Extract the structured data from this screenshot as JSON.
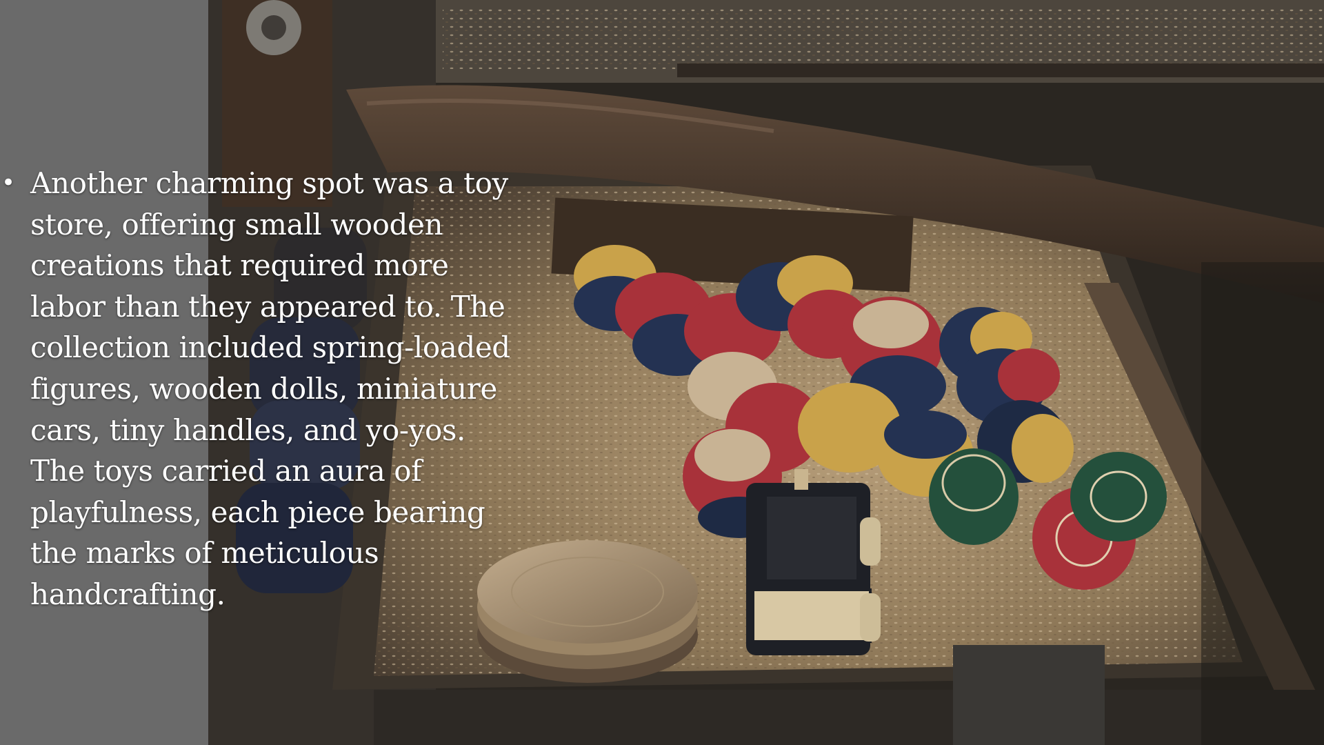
{
  "slide": {
    "bullet_text": "Another charming spot was a toy store, offering small wooden creations that required more labor than they appeared to. The collection included spring-loaded figures, wooden dolls, miniature cars, tiny handles, and yo-yos. The toys carried an aura of playfulness, each piece bearing the marks of meticulous handcrafting."
  },
  "photo": {
    "subject": "wooden-toys-in-sawdust",
    "colors": {
      "sawdust": "#a8906e",
      "wood_dark": "#3a2e24",
      "red_lacquer": "#a8323a",
      "blue_lacquer": "#243252",
      "yellow_lacquer": "#c9a24a",
      "green_lacquer": "#24503c"
    }
  }
}
